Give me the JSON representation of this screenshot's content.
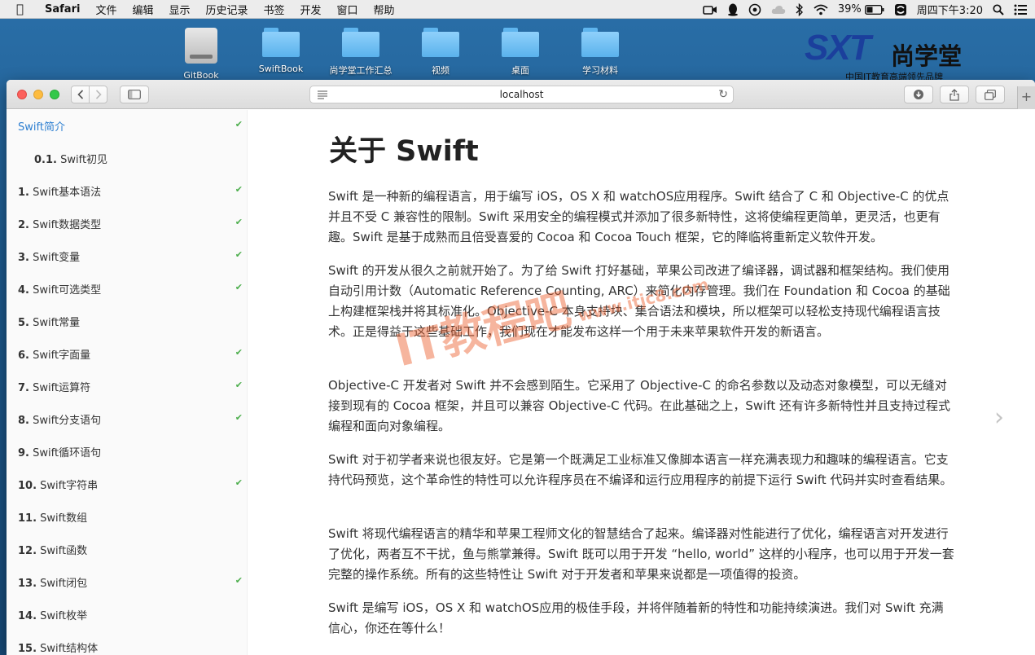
{
  "menubar": {
    "app_name": "Safari",
    "items": [
      "文件",
      "编辑",
      "显示",
      "历史记录",
      "书签",
      "开发",
      "窗口",
      "帮助"
    ],
    "battery": "39%",
    "clock": "周四下午3:20"
  },
  "desktop": {
    "icons": [
      "GitBook",
      "SwiftBook",
      "尚学堂工作汇总",
      "视频",
      "桌面",
      "学习材料"
    ],
    "brand_mark": "SXT",
    "brand_name": "尚学堂",
    "brand_sub": "中国IT教育高端领先品牌"
  },
  "browser": {
    "url": "localhost"
  },
  "sidebar": {
    "items": [
      {
        "num": "",
        "label": "Swift简介",
        "checked": true,
        "active": true
      },
      {
        "num": "0.1.",
        "label": "Swift初见",
        "checked": false
      },
      {
        "num": "1.",
        "label": "Swift基本语法",
        "checked": true
      },
      {
        "num": "2.",
        "label": "Swift数据类型",
        "checked": true
      },
      {
        "num": "3.",
        "label": "Swift变量",
        "checked": true
      },
      {
        "num": "4.",
        "label": "Swift可选类型",
        "checked": true
      },
      {
        "num": "5.",
        "label": "Swift常量",
        "checked": false
      },
      {
        "num": "6.",
        "label": "Swift字面量",
        "checked": true
      },
      {
        "num": "7.",
        "label": "Swift运算符",
        "checked": true
      },
      {
        "num": "8.",
        "label": "Swift分支语句",
        "checked": true
      },
      {
        "num": "9.",
        "label": "Swift循环语句",
        "checked": false
      },
      {
        "num": "10.",
        "label": "Swift字符串",
        "checked": true
      },
      {
        "num": "11.",
        "label": "Swift数组",
        "checked": false
      },
      {
        "num": "12.",
        "label": "Swift函数",
        "checked": false
      },
      {
        "num": "13.",
        "label": "Swift闭包",
        "checked": true
      },
      {
        "num": "14.",
        "label": "Swift枚举",
        "checked": false
      },
      {
        "num": "15.",
        "label": "Swift结构体",
        "checked": false
      }
    ]
  },
  "content": {
    "title": "关于 Swift",
    "paragraphs": [
      "Swift 是一种新的编程语言，用于编写 iOS，OS X 和 watchOS应用程序。Swift 结合了 C 和 Objective-C 的优点并且不受 C 兼容性的限制。Swift 采用安全的编程模式并添加了很多新特性，这将使编程更简单，更灵活，也更有趣。Swift 是基于成熟而且倍受喜爱的 Cocoa 和 Cocoa Touch 框架，它的降临将重新定义软件开发。",
      "Swift 的开发从很久之前就开始了。为了给 Swift 打好基础，苹果公司改进了编译器，调试器和框架结构。我们使用自动引用计数（Automatic Reference Counting, ARC）来简化内存管理。我们在 Foundation 和 Cocoa 的基础上构建框架栈并将其标准化。Objective-C 本身支持块、集合语法和模块，所以框架可以轻松支持现代编程语言技术。正是得益于这些基础工作，我们现在才能发布这样一个用于未来苹果软件开发的新语言。",
      "Objective-C 开发者对 Swift 并不会感到陌生。它采用了 Objective-C 的命名参数以及动态对象模型，可以无缝对接到现有的 Cocoa 框架，并且可以兼容 Objective-C 代码。在此基础之上，Swift 还有许多新特性并且支持过程式编程和面向对象编程。",
      "Swift 对于初学者来说也很友好。它是第一个既满足工业标准又像脚本语言一样充满表现力和趣味的编程语言。它支持代码预览，这个革命性的特性可以允许程序员在不编译和运行应用程序的前提下运行 Swift 代码并实时查看结果。",
      "Swift 将现代编程语言的精华和苹果工程师文化的智慧结合了起来。编译器对性能进行了优化，编程语言对开发进行了优化，两者互不干扰，鱼与熊掌兼得。Swift 既可以用于开发 “hello, world” 这样的小程序，也可以用于开发一套完整的操作系统。所有的这些特性让 Swift 对于开发者和苹果来说都是一项值得的投资。",
      "Swift 是编写 iOS，OS X 和 watchOS应用的极佳手段，并将伴随着新的特性和功能持续演进。我们对 Swift 充满信心，你还在等什么！"
    ]
  },
  "watermark": {
    "text": "IT教程吧",
    "url": "www.itjc8.com"
  }
}
